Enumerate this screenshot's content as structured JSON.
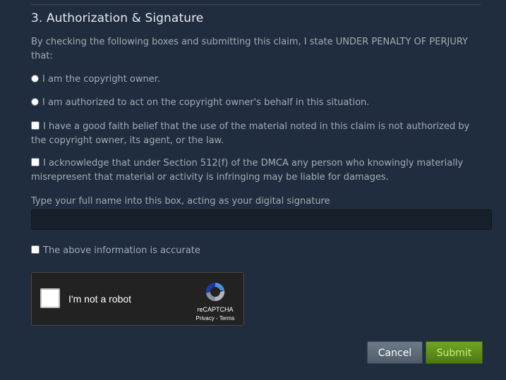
{
  "section": {
    "title": "3. Authorization & Signature",
    "intro": "By checking the following boxes and submitting this claim, I state UNDER PENALTY OF PERJURY that:"
  },
  "options": {
    "owner": "I am the copyright owner.",
    "authorized": "I am authorized to act on the copyright owner's behalf in this situation.",
    "good_faith": "I have a good faith belief that the use of the material noted in this claim is not authorized by the copyright owner, its agent, or the law.",
    "acknowledge": "I acknowledge that under Section 512(f) of the DMCA any person who knowingly materially misrepresent that material or activity is infringing may be liable for damages."
  },
  "signature": {
    "label": "Type your full name into this box, acting as your digital signature",
    "value": "",
    "placeholder": ""
  },
  "accurate": {
    "label": "The above information is accurate"
  },
  "recaptcha": {
    "label": "I'm not a robot",
    "brand": "reCAPTCHA",
    "links": "Privacy - Terms",
    "icon": "recaptcha-logo"
  },
  "buttons": {
    "cancel": "Cancel",
    "submit": "Submit"
  },
  "colors": {
    "background": "#1f2d3e",
    "submit": "#5c8a19",
    "cancel": "#5f6c7a"
  }
}
